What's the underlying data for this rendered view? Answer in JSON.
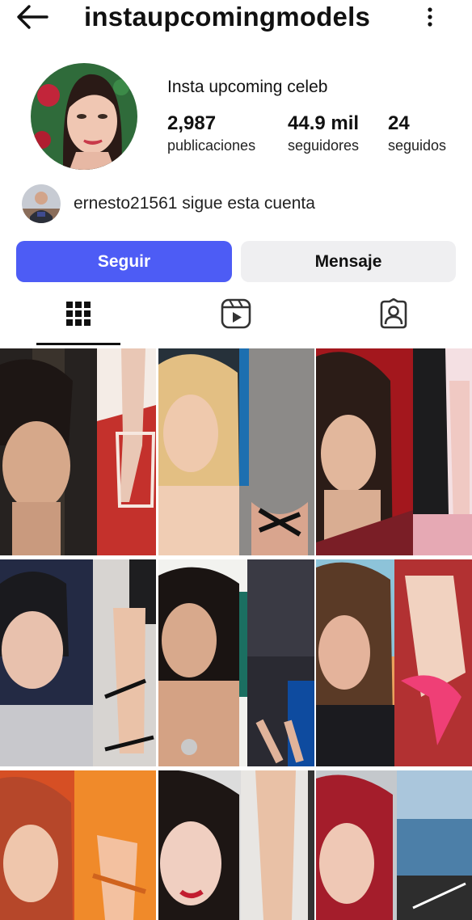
{
  "header": {
    "username": "instaupcomingmodels",
    "back_icon": "arrow-left-icon",
    "menu_icon": "more-vertical-icon"
  },
  "profile": {
    "display_name": "Insta upcoming celeb",
    "stats": [
      {
        "value": "2,987",
        "label": "publicaciones"
      },
      {
        "value": "44.9 mil",
        "label": "seguidores"
      },
      {
        "value": "24",
        "label": "seguidos"
      }
    ]
  },
  "followed_by": {
    "username": "ernesto21561",
    "text": " sigue esta cuenta"
  },
  "actions": {
    "follow_label": "Seguir",
    "message_label": "Mensaje"
  },
  "tabs": [
    {
      "icon": "grid-icon",
      "active": true
    },
    {
      "icon": "reels-icon",
      "active": false
    },
    {
      "icon": "tagged-icon",
      "active": false
    }
  ],
  "colors": {
    "accent": "#4d5cf5",
    "secondary_button": "#efeff1"
  },
  "posts": [
    {
      "id": "post-1"
    },
    {
      "id": "post-2"
    },
    {
      "id": "post-3"
    },
    {
      "id": "post-4"
    },
    {
      "id": "post-5"
    },
    {
      "id": "post-6"
    },
    {
      "id": "post-7"
    },
    {
      "id": "post-8"
    },
    {
      "id": "post-9"
    }
  ]
}
